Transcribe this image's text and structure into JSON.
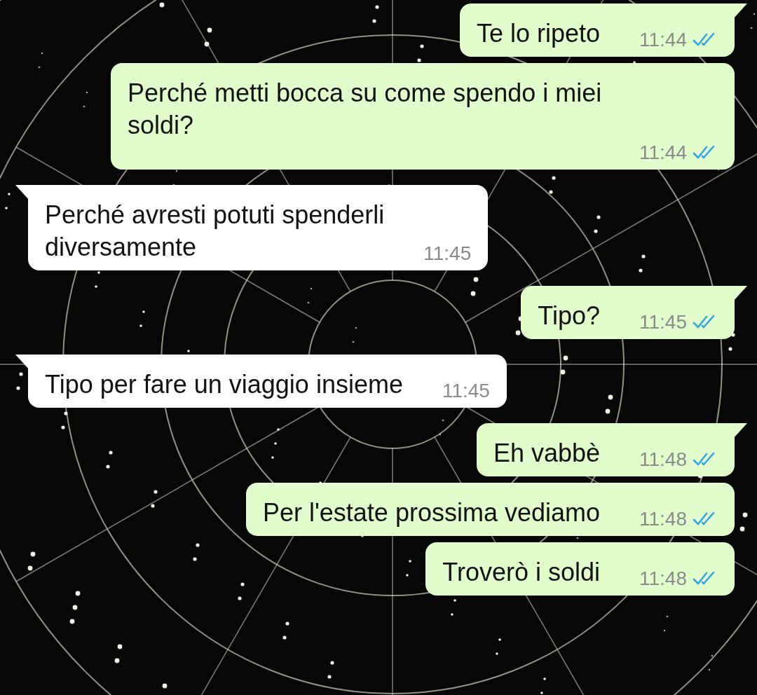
{
  "messages": [
    {
      "kind": "outgoing",
      "tail": true,
      "lines": [
        "Te lo ripeto"
      ],
      "time": "11:44",
      "read": true
    },
    {
      "kind": "outgoing",
      "tail": false,
      "lines": [
        "Perché metti bocca su come spendo i miei",
        "soldi?"
      ],
      "time": "11:44",
      "read": true
    },
    {
      "kind": "incoming",
      "tail": true,
      "lines": [
        "Perché avresti potuti spenderli",
        "diversamente"
      ],
      "time": "11:45"
    },
    {
      "kind": "outgoing",
      "tail": true,
      "lines": [
        "Tipo?"
      ],
      "time": "11:45",
      "read": true
    },
    {
      "kind": "incoming",
      "tail": true,
      "lines": [
        "Tipo per fare un viaggio insieme"
      ],
      "time": "11:45"
    },
    {
      "kind": "outgoing",
      "tail": true,
      "lines": [
        "Eh vabbè"
      ],
      "time": "11:48",
      "read": true
    },
    {
      "kind": "outgoing",
      "tail": false,
      "lines": [
        "Per l'estate prossima vediamo"
      ],
      "time": "11:48",
      "read": true
    },
    {
      "kind": "outgoing",
      "tail": false,
      "lines": [
        "Troverò i soldi"
      ],
      "time": "11:48",
      "read": true
    }
  ]
}
